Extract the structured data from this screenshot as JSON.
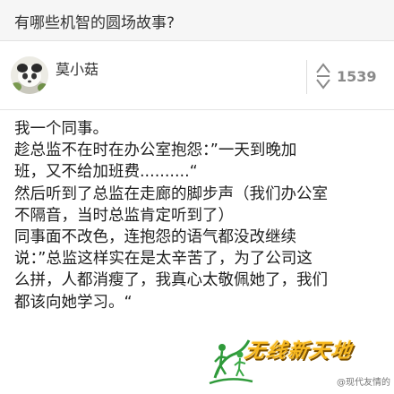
{
  "question": {
    "title": "有哪些机智的圆场故事?"
  },
  "author": {
    "name": "莫小菇",
    "avatar_icon": "author-avatar-photo"
  },
  "vote": {
    "icon": "vote-updown-icon",
    "count": "1539"
  },
  "answer": {
    "lines": [
      "我一个同事。",
      "趁总监不在时在办公室抱怨：”一天到晚加",
      "班，又不给加班费..........“",
      "然后听到了总监在走廊的脚步声（我们办公室",
      "不隔音，当时总监肯定听到了）",
      "同事面不改色，连抱怨的语气都没改继续",
      "说：”总监这样实在是太辛苦了，为了公司这",
      "么拼，人都消瘦了，我真心太敬佩她了，我们",
      "都该向她学习。“"
    ]
  },
  "watermark": {
    "logo_text": "无线新天地",
    "weibo_text": "@现代友情的",
    "colors": {
      "logo": "#f7b81f",
      "logo_green": "#2f9a3a"
    }
  },
  "colors": {
    "header_bg": "#f6f6f6",
    "text": "#1e1e1e",
    "vote_gray": "#8a8a8a"
  }
}
